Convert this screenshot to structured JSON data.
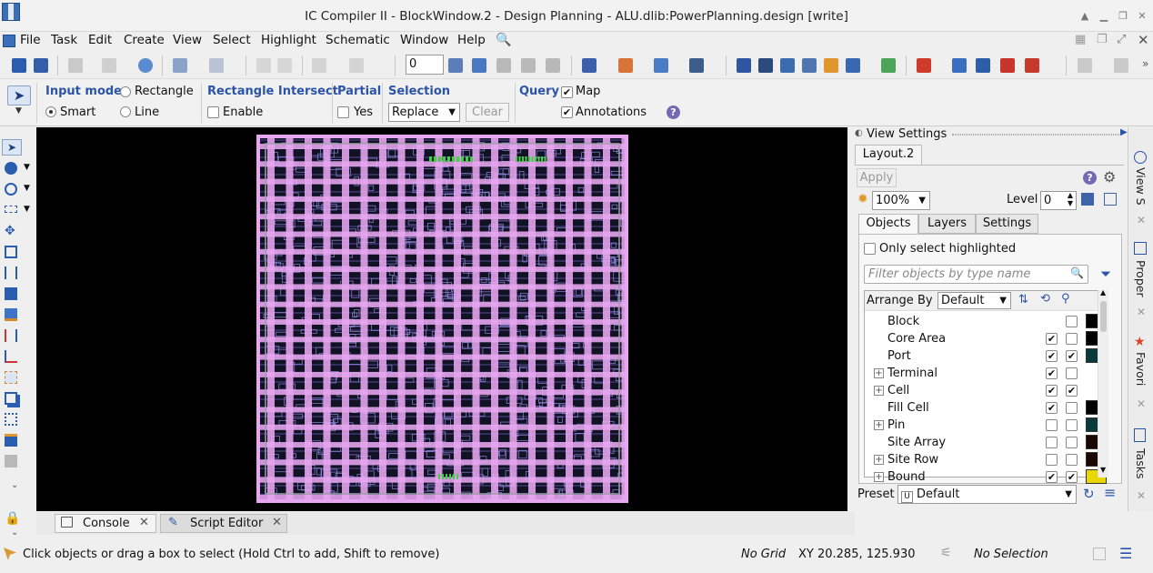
{
  "window": {
    "title": "IC Compiler II - BlockWindow.2 - Design Planning - ALU.dlib:PowerPlanning.design [write]"
  },
  "menu": [
    "File",
    "Task",
    "Edit",
    "Create",
    "View",
    "Select",
    "Highlight",
    "Schematic",
    "Window",
    "Help"
  ],
  "toolbar": {
    "spin_value": "0"
  },
  "options": {
    "input_mode_label": "Input mode",
    "rectangle": "Rectangle",
    "smart": "Smart",
    "line": "Line",
    "rect_intersect_label": "Rectangle Intersect",
    "enable": "Enable",
    "partial_label": "Partial",
    "yes": "Yes",
    "selection_label": "Selection",
    "selection_value": "Replace",
    "clear": "Clear",
    "query_label": "Query",
    "map": "Map",
    "annotations": "Annotations",
    "input_mode": "Smart"
  },
  "view_settings": {
    "header": "View Settings",
    "layout_tab": "Layout.2",
    "apply": "Apply",
    "zoom": "100%",
    "level_label": "Level",
    "level_value": "0",
    "tabs": [
      "Objects",
      "Layers",
      "Settings"
    ],
    "only_select": "Only select highlighted",
    "filter_placeholder": "Filter objects by type name",
    "arrange_by_label": "Arrange By",
    "arrange_by_value": "Default",
    "objects": [
      {
        "name": "Block",
        "expand": false,
        "visible": null,
        "selectable": false,
        "color": "#000000"
      },
      {
        "name": "Core Area",
        "expand": false,
        "visible": true,
        "selectable": false,
        "color": "#000000"
      },
      {
        "name": "Port",
        "expand": false,
        "visible": true,
        "selectable": true,
        "color": "#0b3a3a"
      },
      {
        "name": "Terminal",
        "expand": true,
        "visible": true,
        "selectable": false,
        "color": ""
      },
      {
        "name": "Cell",
        "expand": true,
        "visible": true,
        "selectable": true,
        "color": ""
      },
      {
        "name": "Fill Cell",
        "expand": false,
        "visible": true,
        "selectable": false,
        "color": "#000000"
      },
      {
        "name": "Pin",
        "expand": true,
        "visible": false,
        "selectable": false,
        "color": "#0b3a3a"
      },
      {
        "name": "Site Array",
        "expand": false,
        "visible": false,
        "selectable": false,
        "color": "#1a0800"
      },
      {
        "name": "Site Row",
        "expand": true,
        "visible": false,
        "selectable": false,
        "color": "#1a0800"
      },
      {
        "name": "Bound",
        "expand": true,
        "visible": true,
        "selectable": true,
        "color": "#e8d800"
      }
    ],
    "preset_label": "Preset",
    "preset_value": "Default",
    "preset_badge": "U"
  },
  "side_tabs": [
    "View S",
    "Proper",
    "Favori",
    "Tasks"
  ],
  "bottom_tabs": {
    "console": "Console",
    "script_editor": "Script Editor"
  },
  "status": {
    "hint": "Click objects or drag a box to select (Hold Ctrl to add, Shift to remove)",
    "grid": "No Grid",
    "coords": "XY 20.285, 125.930",
    "selection": "No Selection"
  },
  "colors": {
    "accent": "#2b54a8",
    "layout_stripe": "#e7a6f0",
    "canvas": "#000000"
  }
}
